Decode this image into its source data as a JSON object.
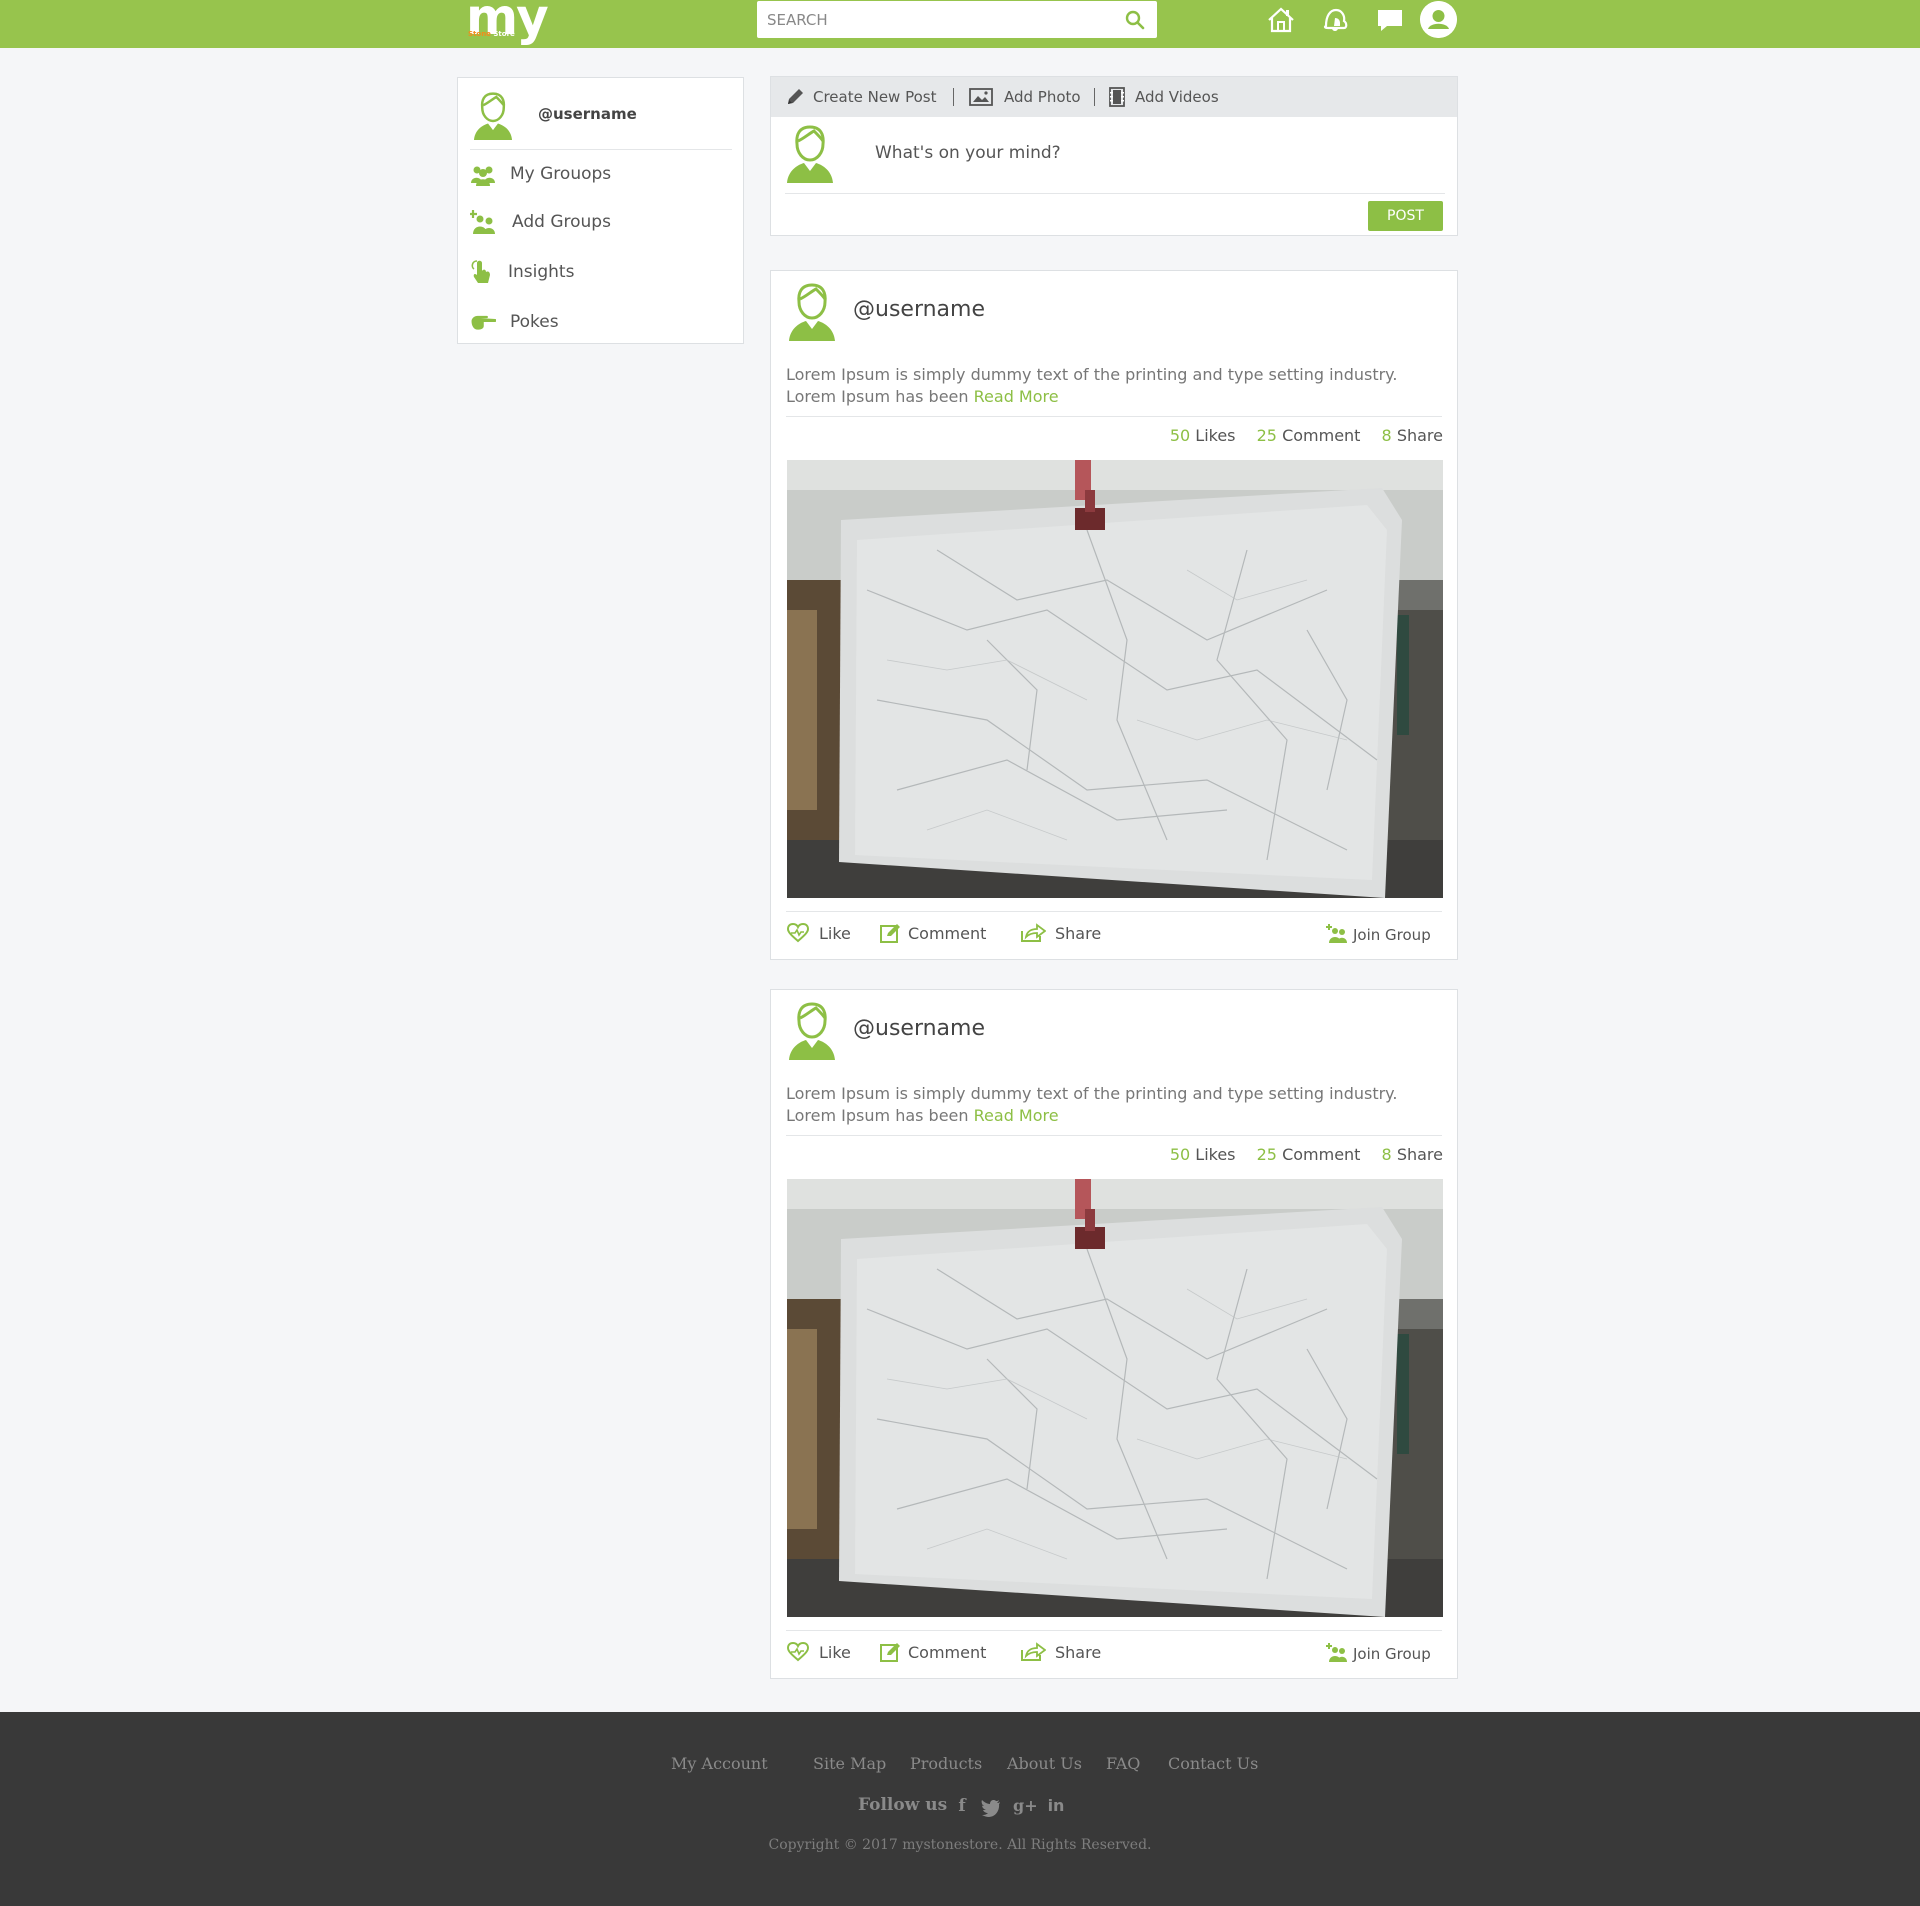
{
  "colors": {
    "brand": "#97c44d",
    "accent": "#8dbf45",
    "footer_bg": "#393939",
    "page_bg": "#f5f6f8"
  },
  "header": {
    "logo_text": "my",
    "logo_sub_a": "Stone",
    "logo_sub_b": "Store",
    "search_placeholder": "SEARCH",
    "icons": [
      "search-icon",
      "home-icon",
      "notification-icon",
      "messages-icon",
      "user-avatar-icon"
    ]
  },
  "sidebar": {
    "username": "@username",
    "items": [
      {
        "label": "My Grouops",
        "icon": "groups-icon"
      },
      {
        "label": "Add Groups",
        "icon": "add-group-icon"
      },
      {
        "label": "Insights",
        "icon": "insights-icon"
      },
      {
        "label": "Pokes",
        "icon": "poke-icon"
      }
    ]
  },
  "composer": {
    "tabs": [
      {
        "label": "Create New Post",
        "icon": "pencil-icon"
      },
      {
        "label": "Add Photo",
        "icon": "photo-icon"
      },
      {
        "label": "Add Videos",
        "icon": "video-icon"
      }
    ],
    "placeholder": "What's on your mind?",
    "post_button": "POST"
  },
  "posts": [
    {
      "username": "@username",
      "text": "Lorem Ipsum is simply dummy text of the printing and type setting industry. Lorem Ipsum has been",
      "read_more": "Read More",
      "likes_count": "50",
      "likes_label": "Likes",
      "comments_count": "25",
      "comments_label": "Comment",
      "shares_count": "8",
      "shares_label": "Share",
      "actions": {
        "like": "Like",
        "comment": "Comment",
        "share": "Share",
        "join": "Join Group"
      }
    },
    {
      "username": "@username",
      "text": "Lorem Ipsum is simply dummy text of the printing and type setting industry. Lorem Ipsum has been",
      "read_more": "Read More",
      "likes_count": "50",
      "likes_label": "Likes",
      "comments_count": "25",
      "comments_label": "Comment",
      "shares_count": "8",
      "shares_label": "Share",
      "actions": {
        "like": "Like",
        "comment": "Comment",
        "share": "Share",
        "join": "Join Group"
      }
    }
  ],
  "footer": {
    "links": [
      "My Account",
      "Site Map",
      "Products",
      "About Us",
      "FAQ",
      "Contact Us"
    ],
    "follow_label": "Follow us",
    "social": [
      {
        "glyph": "f",
        "icon": "facebook-icon"
      },
      {
        "glyph": "t",
        "icon": "twitter-icon"
      },
      {
        "glyph": "g+",
        "icon": "google-plus-icon"
      },
      {
        "glyph": "in",
        "icon": "linkedin-icon"
      }
    ],
    "copyright": "Copyright © 2017  mystonestore.  All Rights Reserved."
  }
}
